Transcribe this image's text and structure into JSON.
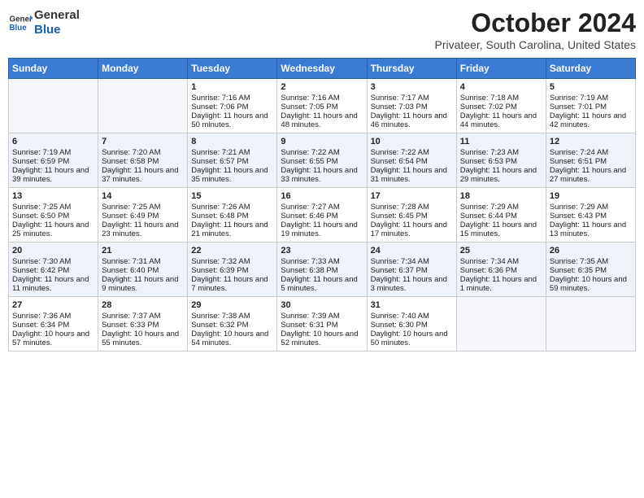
{
  "header": {
    "logo_line1": "General",
    "logo_line2": "Blue",
    "title": "October 2024",
    "subtitle": "Privateer, South Carolina, United States"
  },
  "days_of_week": [
    "Sunday",
    "Monday",
    "Tuesday",
    "Wednesday",
    "Thursday",
    "Friday",
    "Saturday"
  ],
  "weeks": [
    [
      {
        "day": "",
        "sunrise": "",
        "sunset": "",
        "daylight": ""
      },
      {
        "day": "",
        "sunrise": "",
        "sunset": "",
        "daylight": ""
      },
      {
        "day": "1",
        "sunrise": "Sunrise: 7:16 AM",
        "sunset": "Sunset: 7:06 PM",
        "daylight": "Daylight: 11 hours and 50 minutes."
      },
      {
        "day": "2",
        "sunrise": "Sunrise: 7:16 AM",
        "sunset": "Sunset: 7:05 PM",
        "daylight": "Daylight: 11 hours and 48 minutes."
      },
      {
        "day": "3",
        "sunrise": "Sunrise: 7:17 AM",
        "sunset": "Sunset: 7:03 PM",
        "daylight": "Daylight: 11 hours and 46 minutes."
      },
      {
        "day": "4",
        "sunrise": "Sunrise: 7:18 AM",
        "sunset": "Sunset: 7:02 PM",
        "daylight": "Daylight: 11 hours and 44 minutes."
      },
      {
        "day": "5",
        "sunrise": "Sunrise: 7:19 AM",
        "sunset": "Sunset: 7:01 PM",
        "daylight": "Daylight: 11 hours and 42 minutes."
      }
    ],
    [
      {
        "day": "6",
        "sunrise": "Sunrise: 7:19 AM",
        "sunset": "Sunset: 6:59 PM",
        "daylight": "Daylight: 11 hours and 39 minutes."
      },
      {
        "day": "7",
        "sunrise": "Sunrise: 7:20 AM",
        "sunset": "Sunset: 6:58 PM",
        "daylight": "Daylight: 11 hours and 37 minutes."
      },
      {
        "day": "8",
        "sunrise": "Sunrise: 7:21 AM",
        "sunset": "Sunset: 6:57 PM",
        "daylight": "Daylight: 11 hours and 35 minutes."
      },
      {
        "day": "9",
        "sunrise": "Sunrise: 7:22 AM",
        "sunset": "Sunset: 6:55 PM",
        "daylight": "Daylight: 11 hours and 33 minutes."
      },
      {
        "day": "10",
        "sunrise": "Sunrise: 7:22 AM",
        "sunset": "Sunset: 6:54 PM",
        "daylight": "Daylight: 11 hours and 31 minutes."
      },
      {
        "day": "11",
        "sunrise": "Sunrise: 7:23 AM",
        "sunset": "Sunset: 6:53 PM",
        "daylight": "Daylight: 11 hours and 29 minutes."
      },
      {
        "day": "12",
        "sunrise": "Sunrise: 7:24 AM",
        "sunset": "Sunset: 6:51 PM",
        "daylight": "Daylight: 11 hours and 27 minutes."
      }
    ],
    [
      {
        "day": "13",
        "sunrise": "Sunrise: 7:25 AM",
        "sunset": "Sunset: 6:50 PM",
        "daylight": "Daylight: 11 hours and 25 minutes."
      },
      {
        "day": "14",
        "sunrise": "Sunrise: 7:25 AM",
        "sunset": "Sunset: 6:49 PM",
        "daylight": "Daylight: 11 hours and 23 minutes."
      },
      {
        "day": "15",
        "sunrise": "Sunrise: 7:26 AM",
        "sunset": "Sunset: 6:48 PM",
        "daylight": "Daylight: 11 hours and 21 minutes."
      },
      {
        "day": "16",
        "sunrise": "Sunrise: 7:27 AM",
        "sunset": "Sunset: 6:46 PM",
        "daylight": "Daylight: 11 hours and 19 minutes."
      },
      {
        "day": "17",
        "sunrise": "Sunrise: 7:28 AM",
        "sunset": "Sunset: 6:45 PM",
        "daylight": "Daylight: 11 hours and 17 minutes."
      },
      {
        "day": "18",
        "sunrise": "Sunrise: 7:29 AM",
        "sunset": "Sunset: 6:44 PM",
        "daylight": "Daylight: 11 hours and 15 minutes."
      },
      {
        "day": "19",
        "sunrise": "Sunrise: 7:29 AM",
        "sunset": "Sunset: 6:43 PM",
        "daylight": "Daylight: 11 hours and 13 minutes."
      }
    ],
    [
      {
        "day": "20",
        "sunrise": "Sunrise: 7:30 AM",
        "sunset": "Sunset: 6:42 PM",
        "daylight": "Daylight: 11 hours and 11 minutes."
      },
      {
        "day": "21",
        "sunrise": "Sunrise: 7:31 AM",
        "sunset": "Sunset: 6:40 PM",
        "daylight": "Daylight: 11 hours and 9 minutes."
      },
      {
        "day": "22",
        "sunrise": "Sunrise: 7:32 AM",
        "sunset": "Sunset: 6:39 PM",
        "daylight": "Daylight: 11 hours and 7 minutes."
      },
      {
        "day": "23",
        "sunrise": "Sunrise: 7:33 AM",
        "sunset": "Sunset: 6:38 PM",
        "daylight": "Daylight: 11 hours and 5 minutes."
      },
      {
        "day": "24",
        "sunrise": "Sunrise: 7:34 AM",
        "sunset": "Sunset: 6:37 PM",
        "daylight": "Daylight: 11 hours and 3 minutes."
      },
      {
        "day": "25",
        "sunrise": "Sunrise: 7:34 AM",
        "sunset": "Sunset: 6:36 PM",
        "daylight": "Daylight: 11 hours and 1 minute."
      },
      {
        "day": "26",
        "sunrise": "Sunrise: 7:35 AM",
        "sunset": "Sunset: 6:35 PM",
        "daylight": "Daylight: 10 hours and 59 minutes."
      }
    ],
    [
      {
        "day": "27",
        "sunrise": "Sunrise: 7:36 AM",
        "sunset": "Sunset: 6:34 PM",
        "daylight": "Daylight: 10 hours and 57 minutes."
      },
      {
        "day": "28",
        "sunrise": "Sunrise: 7:37 AM",
        "sunset": "Sunset: 6:33 PM",
        "daylight": "Daylight: 10 hours and 55 minutes."
      },
      {
        "day": "29",
        "sunrise": "Sunrise: 7:38 AM",
        "sunset": "Sunset: 6:32 PM",
        "daylight": "Daylight: 10 hours and 54 minutes."
      },
      {
        "day": "30",
        "sunrise": "Sunrise: 7:39 AM",
        "sunset": "Sunset: 6:31 PM",
        "daylight": "Daylight: 10 hours and 52 minutes."
      },
      {
        "day": "31",
        "sunrise": "Sunrise: 7:40 AM",
        "sunset": "Sunset: 6:30 PM",
        "daylight": "Daylight: 10 hours and 50 minutes."
      },
      {
        "day": "",
        "sunrise": "",
        "sunset": "",
        "daylight": ""
      },
      {
        "day": "",
        "sunrise": "",
        "sunset": "",
        "daylight": ""
      }
    ]
  ]
}
